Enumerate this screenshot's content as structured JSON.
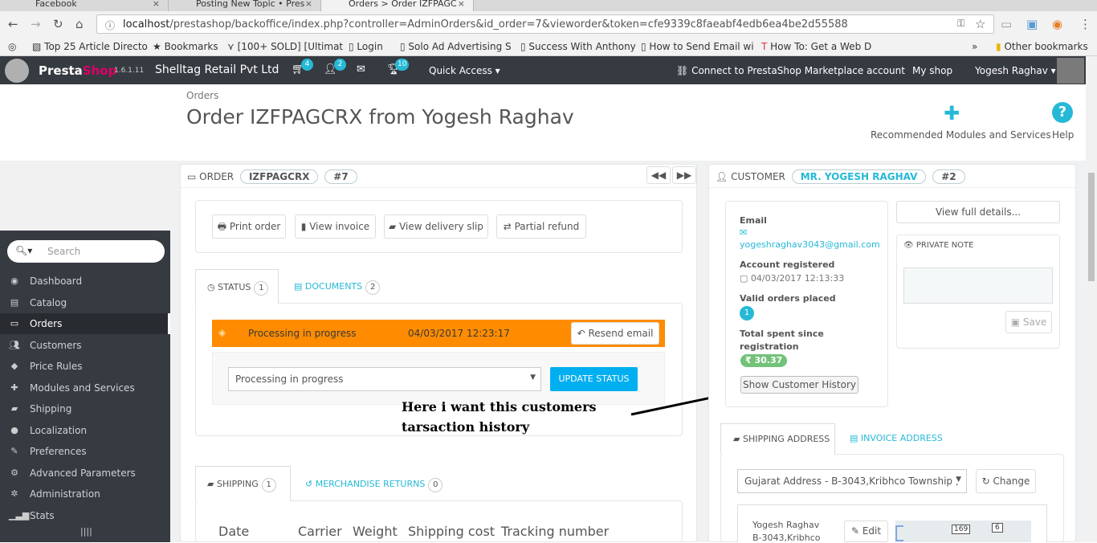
{
  "browser": {
    "tabs": [
      {
        "title": "Facebook",
        "close": "×"
      },
      {
        "title": "Posting New Topic • Pres",
        "close": "×"
      },
      {
        "title": "Orders > Order IZFPAGC",
        "close": "×"
      }
    ],
    "url_host": "localhost",
    "url_path": "/prestashop/backoffice/index.php?controller=AdminOrders&id_order=7&vieworder&token=cfe9339c8faeabf4edb6ea4be2d55588",
    "bookmarks": [
      "Top 25 Article Directo",
      "Bookmarks",
      "[100+ SOLD] [Ultimat",
      "Login",
      "Solo Ad Advertising S",
      "Success With Anthony",
      "How to Send Email wi",
      "How To: Get a Web D"
    ],
    "other_bookmarks": "Other bookmarks",
    "chevron": "»"
  },
  "header": {
    "brand_a": "Presta",
    "brand_b": "Shop",
    "version": "1.6.1.11",
    "shop_name": "Shelltag Retail Pvt Ltd",
    "badges": {
      "cart": "4",
      "customers": "2",
      "messages": "10"
    },
    "quick_access": "Quick Access ▾",
    "marketplace": "Connect to PrestaShop Marketplace account",
    "my_shop": "My shop",
    "user": "Yogesh Raghav ▾"
  },
  "toolbar": {
    "breadcrumb": "Orders",
    "title": "Order IZFPAGCRX from Yogesh Raghav",
    "recommended": "Recommended Modules and Services",
    "help": "Help"
  },
  "sidebar": {
    "search_placeholder": "Search",
    "items": [
      {
        "label": "Dashboard",
        "icon": "dashboard-icon"
      },
      {
        "label": "Catalog",
        "icon": "catalog-icon"
      },
      {
        "label": "Orders",
        "icon": "orders-icon"
      },
      {
        "label": "Customers",
        "icon": "customers-icon"
      },
      {
        "label": "Price Rules",
        "icon": "price-rules-icon"
      },
      {
        "label": "Modules and Services",
        "icon": "modules-icon"
      },
      {
        "label": "Shipping",
        "icon": "shipping-icon"
      },
      {
        "label": "Localization",
        "icon": "localization-icon"
      },
      {
        "label": "Preferences",
        "icon": "preferences-icon"
      },
      {
        "label": "Advanced Parameters",
        "icon": "advanced-icon"
      },
      {
        "label": "Administration",
        "icon": "administration-icon"
      },
      {
        "label": "Stats",
        "icon": "stats-icon"
      }
    ],
    "active": "Orders"
  },
  "order": {
    "heading": "ORDER",
    "reference": "IZFPAGCRX",
    "id": "#7",
    "buttons": [
      "Print order",
      "View invoice",
      "View delivery slip",
      "Partial refund"
    ],
    "tab_status": "STATUS",
    "tab_status_count": "1",
    "tab_documents": "DOCUMENTS",
    "tab_documents_count": "2",
    "status_text": "Processing in progress",
    "status_date": "04/03/2017 12:23:17",
    "resend_email": "Resend email",
    "select_value": "Processing in progress",
    "update_status": "UPDATE STATUS",
    "tab_shipping": "SHIPPING",
    "tab_shipping_count": "1",
    "tab_returns": "MERCHANDISE RETURNS",
    "tab_returns_count": "0",
    "columns": [
      "Date",
      "Carrier",
      "Weight",
      "Shipping cost",
      "Tracking number"
    ]
  },
  "annotation": {
    "line1": "Here i want this customers",
    "line2": "tarsaction history"
  },
  "customer": {
    "heading": "CUSTOMER",
    "name": "MR. YOGESH RAGHAV",
    "id": "#2",
    "email_label": "Email",
    "email": "yogeshraghav3043@gmail.com",
    "registered_label": "Account registered",
    "registered": "04/03/2017 12:13:33",
    "valid_orders_label": "Valid orders placed",
    "valid_orders": "1",
    "total_spent_label": "Total spent since registration",
    "total_spent": "₹ 30.37",
    "history_button": "Show Customer History",
    "view_full": "View full details...",
    "private_note": "PRIVATE NOTE",
    "save": "Save",
    "tab_shipping_address": "SHIPPING ADDRESS",
    "tab_invoice_address": "INVOICE ADDRESS",
    "address_select": "Gujarat Address - B-3043,Kribhco Township ,",
    "change": "Change",
    "address_name": "Yogesh Raghav",
    "address_line": "B-3043,Kribhco",
    "edit": "Edit",
    "map_badges": [
      "169",
      "6"
    ]
  },
  "colors": {
    "accent": "#25b9d7",
    "status": "#ff8c00",
    "header": "#363a41",
    "pill_green": "#72c279"
  }
}
